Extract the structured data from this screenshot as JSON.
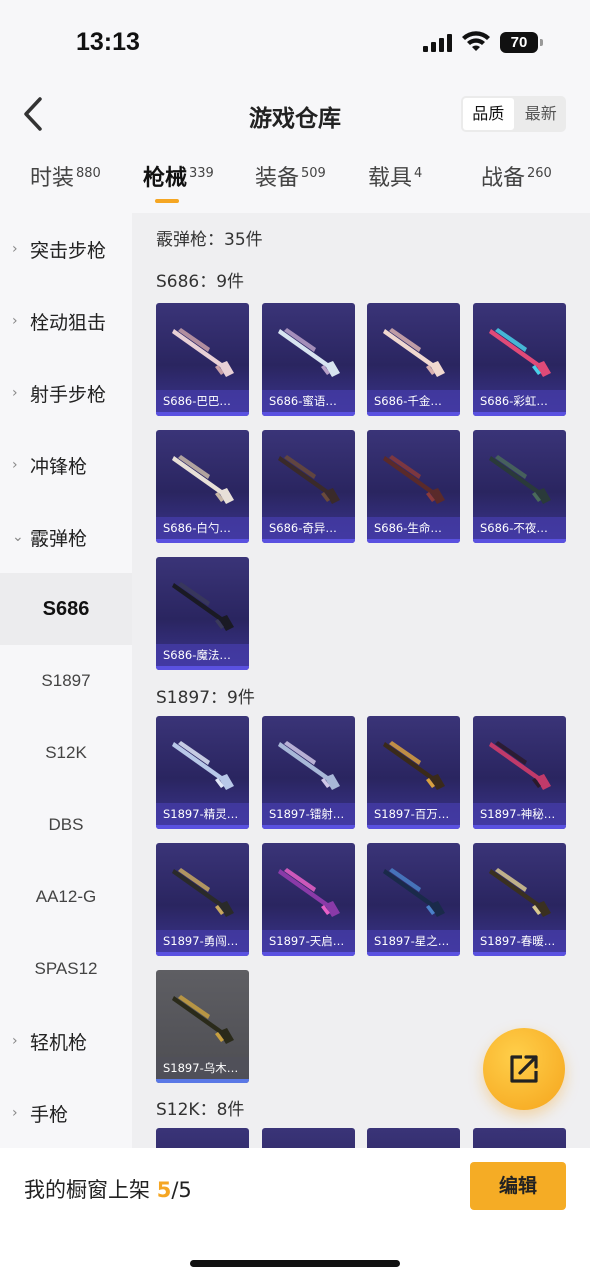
{
  "status_bar": {
    "time": "13:13",
    "battery": "70"
  },
  "header": {
    "title": "游戏仓库",
    "sort_options": [
      "品质",
      "最新"
    ]
  },
  "tabs": [
    {
      "label": "时装",
      "count": "880"
    },
    {
      "label": "枪械",
      "count": "339"
    },
    {
      "label": "装备",
      "count": "509"
    },
    {
      "label": "载具",
      "count": "4"
    },
    {
      "label": "战备",
      "count": "260"
    }
  ],
  "sidebar": {
    "categories": [
      "突击步枪",
      "栓动狙击",
      "射手步枪",
      "冲锋枪",
      "霰弹枪"
    ],
    "subcategories": [
      "S686",
      "S1897",
      "S12K",
      "DBS",
      "AA12-G",
      "SPAS12"
    ],
    "bottom_categories": [
      "轻机枪",
      "手枪"
    ]
  },
  "content": {
    "category_total": "霰弹枪：35件",
    "groups": [
      {
        "label": "S686：9件",
        "items": [
          "S686-巴巴…",
          "S686-蜜语…",
          "S686-千金…",
          "S686-彩虹…",
          "S686-白勺…",
          "S686-奇异…",
          "S686-生命…",
          "S686-不夜…",
          "S686-魔法…"
        ]
      },
      {
        "label": "S1897：9件",
        "items": [
          "S1897-精灵…",
          "S1897-镭射…",
          "S1897-百万…",
          "S1897-神秘…",
          "S1897-勇闯…",
          "S1897-天启…",
          "S1897-星之…",
          "S1897-春暖…",
          "S1897-乌木…"
        ]
      },
      {
        "label": "S12K：8件"
      }
    ]
  },
  "bottom_bar": {
    "label": "我的橱窗上架",
    "current": "5",
    "total": "/5",
    "edit": "编辑"
  },
  "colors": {
    "accent": "#f5a623",
    "card_purple": "#2a2560",
    "card_gray": "#4d4d52"
  }
}
